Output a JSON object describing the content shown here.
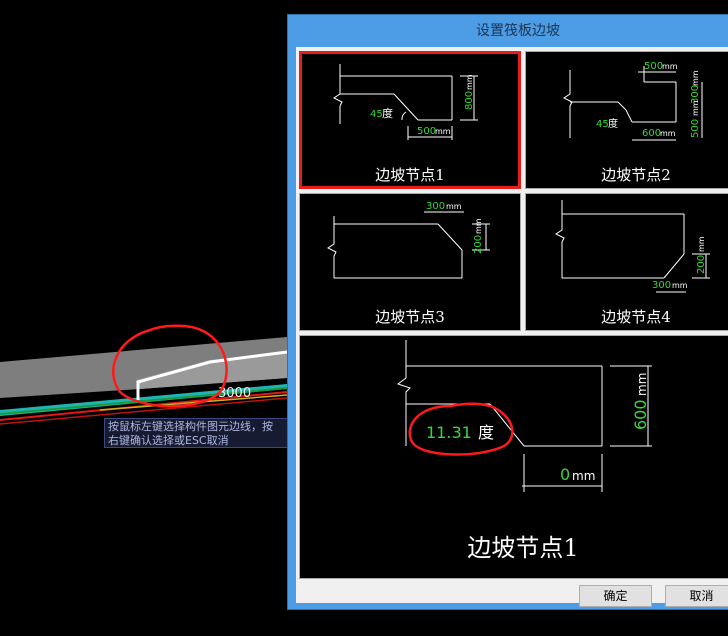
{
  "background": {
    "dimension_label": "3000",
    "hint_line1": "按鼠标左键选择构件图元边线，按",
    "hint_line2": "右键确认选择或ESC取消"
  },
  "dialog": {
    "title": "设置筏板边坡",
    "nodes": [
      {
        "label": "边坡节点1",
        "selected": true,
        "angle": "45",
        "angle_unit": "度",
        "width": "500",
        "height": "800",
        "unit": "mm"
      },
      {
        "label": "边坡节点2",
        "selected": false,
        "angle": "45",
        "angle_unit": "度",
        "top_width": "500",
        "bottom_width": "600",
        "height_upper": "300",
        "height_lower": "500",
        "unit": "mm"
      },
      {
        "label": "边坡节点3",
        "selected": false,
        "width": "300",
        "height": "200",
        "unit": "mm"
      },
      {
        "label": "边坡节点4",
        "selected": false,
        "width": "300",
        "height": "200",
        "unit": "mm"
      }
    ],
    "preview": {
      "label": "边坡节点1",
      "angle_value": "11.31",
      "angle_unit": "度",
      "width_value": "0",
      "height_value": "600",
      "unit": "mm"
    },
    "ok_label": "确定",
    "cancel_label": "取消"
  },
  "colors": {
    "dim_green": "#35d935",
    "selection_red": "#e81c1c",
    "annotation_red": "#ff1a1a",
    "dialog_border": "#4d9ce6"
  }
}
